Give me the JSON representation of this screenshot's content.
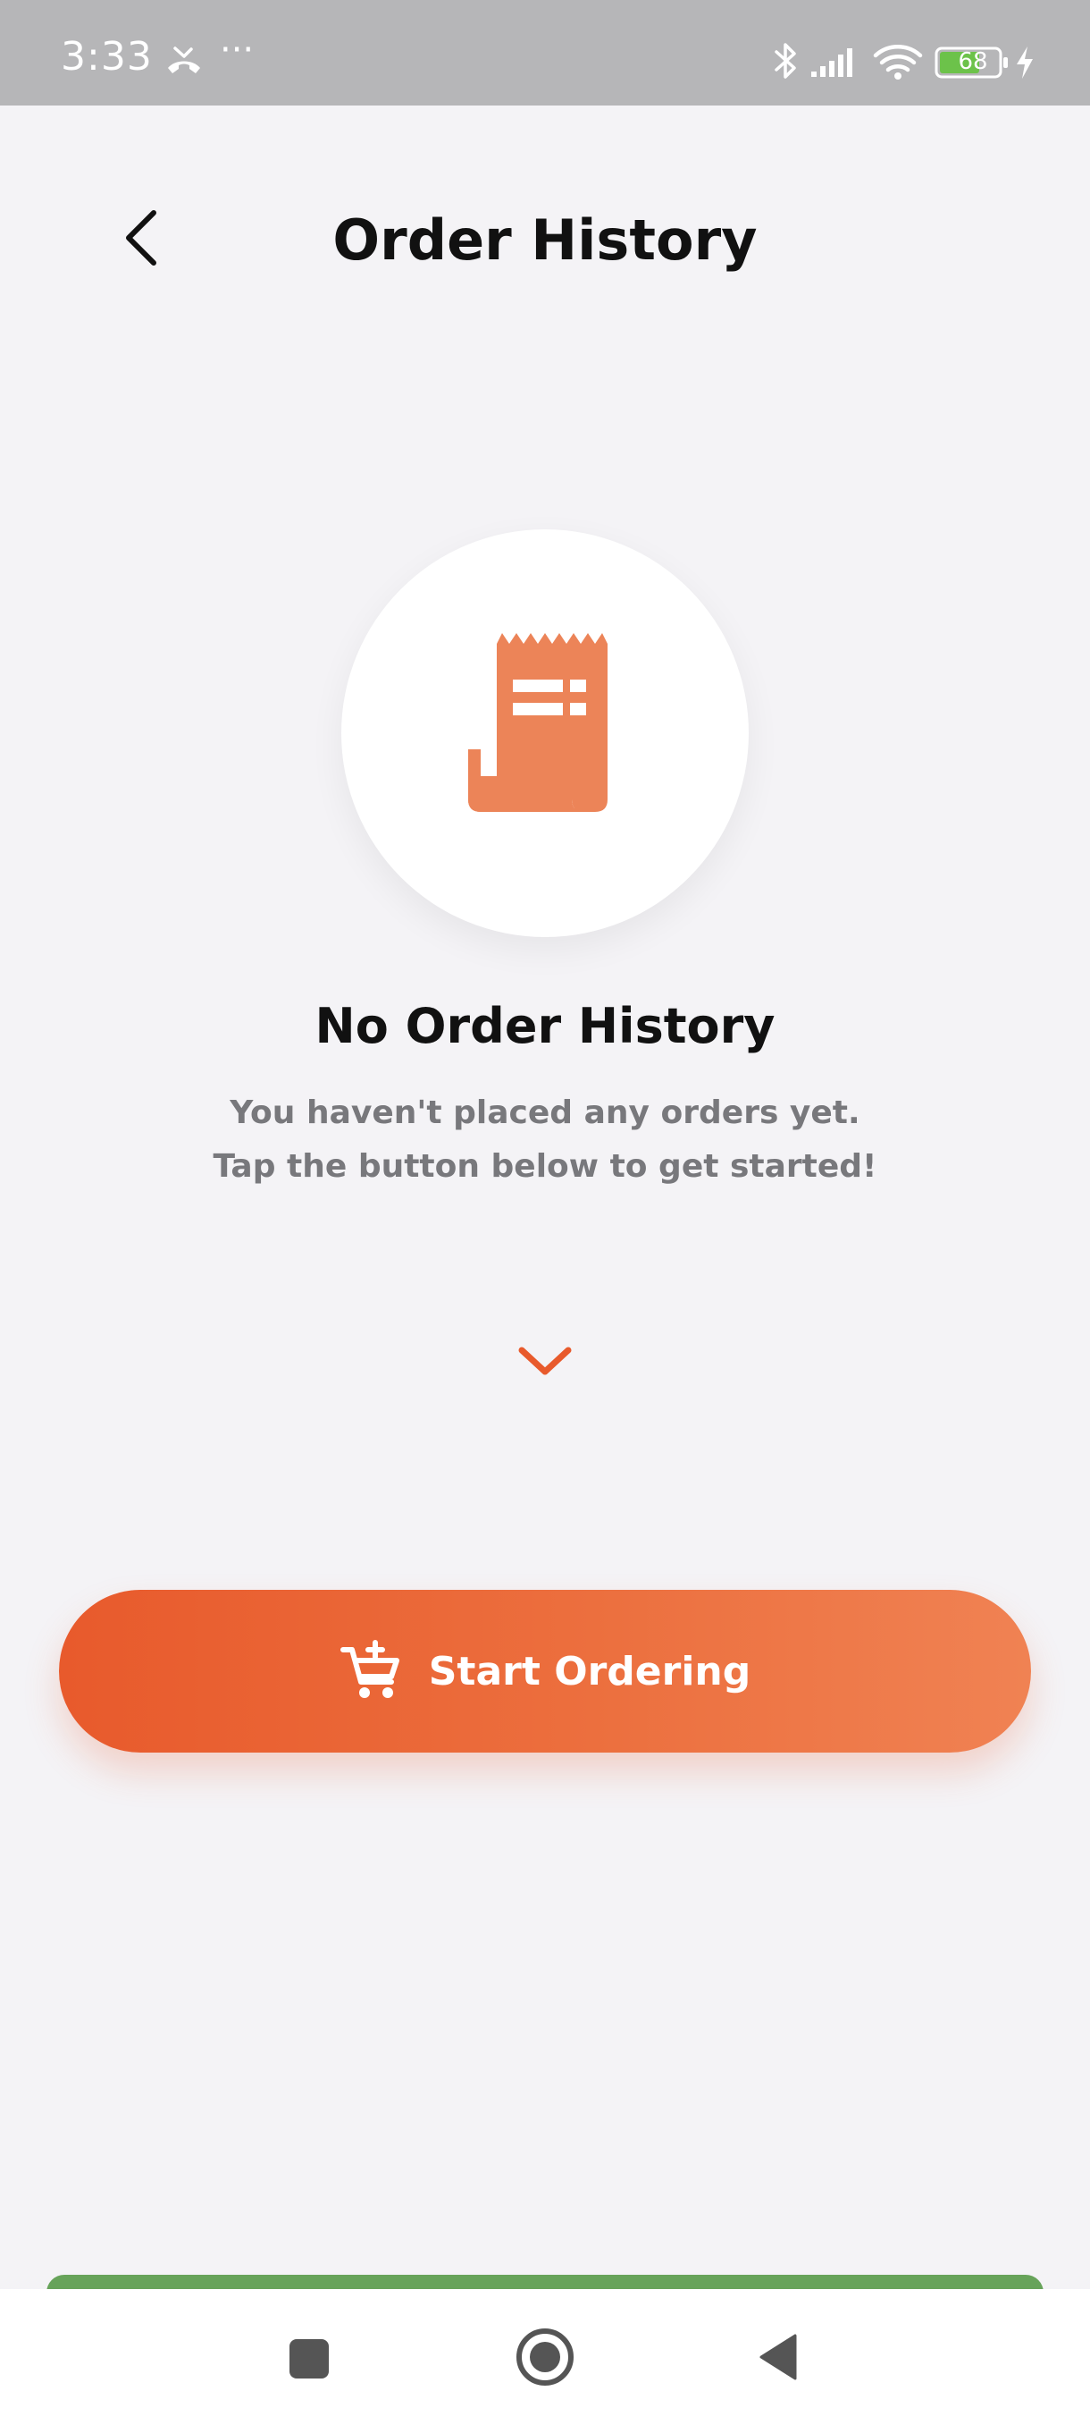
{
  "status_bar": {
    "time": "3:33",
    "more": "···",
    "battery": "68",
    "icons": [
      "missed-call-icon",
      "bluetooth-icon",
      "signal-icon",
      "wifi-icon",
      "battery-icon",
      "charging-icon"
    ],
    "battery_color": "#6cc24a"
  },
  "header": {
    "title": "Order History",
    "back_icon": "chevron-left-icon"
  },
  "empty_state": {
    "icon": "receipt-icon",
    "title": "No Order History",
    "line1": "You haven't placed any orders yet.",
    "line2": "Tap the button below to get started!",
    "indicator_icon": "chevron-down-icon"
  },
  "cta": {
    "label": "Start Ordering",
    "icon": "cart-add-icon"
  },
  "nav": {
    "items": [
      "recents-icon",
      "home-icon",
      "back-icon"
    ]
  },
  "colors": {
    "accent": "#e85a2c",
    "accent_light": "#f08253",
    "background": "#f4f3f6",
    "status_bar": "#b6b6b8",
    "muted_text": "#78787c",
    "green_strip": "#67a35a"
  }
}
